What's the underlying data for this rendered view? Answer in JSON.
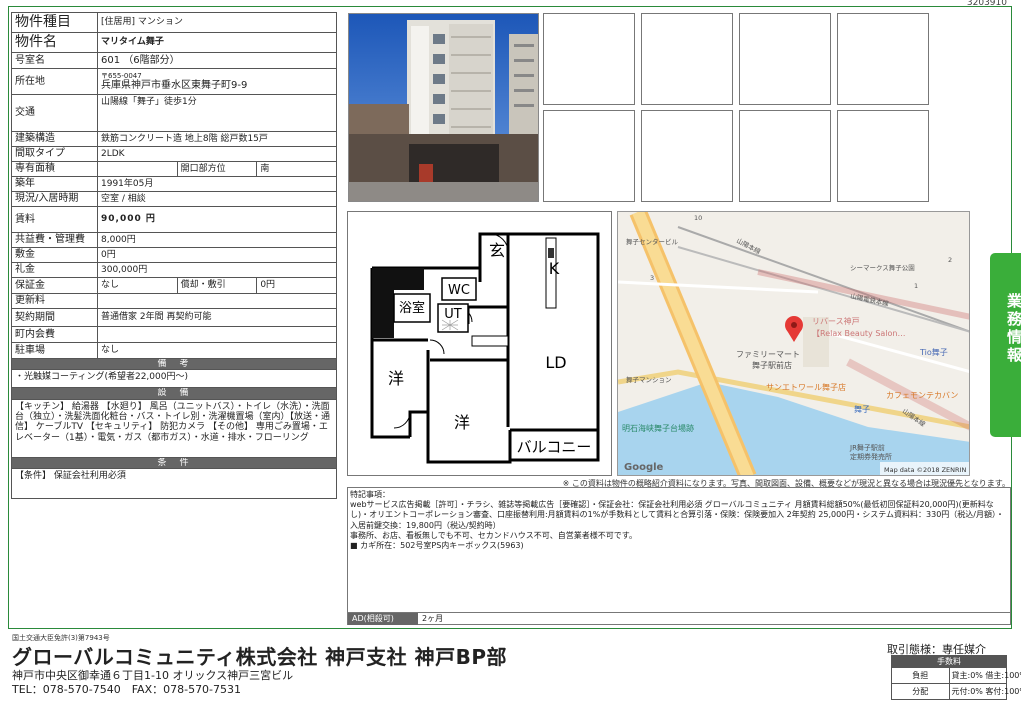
{
  "property_id": "3203910",
  "spec": {
    "type_label": "物件種目",
    "type_value": "[住居用] マンション",
    "name_label": "物件名",
    "name_value": "マリタイム舞子",
    "room_label": "号室名",
    "room_value": "601 （6階部分）",
    "address_label": "所在地",
    "postal": "〒655-0047",
    "address_value": "兵庫県神戸市垂水区東舞子町9-9",
    "access_label": "交通",
    "access_value": "山陽線「舞子」徒歩1分",
    "structure_label": "建築構造",
    "structure_value": "鉄筋コンクリート造 地上8階 総戸数15戸",
    "layout_label": "間取タイプ",
    "layout_value": "2LDK",
    "area_label": "専有面積",
    "area_value": "",
    "opening_label": "開口部方位",
    "opening_value": "南",
    "built_label": "築年",
    "built_value": "1991年05月",
    "status_label": "現況/入居時期",
    "status_value": "空室 / 相談",
    "rent_label": "賃料",
    "rent_value": "90,000 円",
    "fee_label": "共益費・管理費",
    "fee_value": "8,000円",
    "deposit_label": "敷金",
    "deposit_value": "0円",
    "keymoney_label": "礼金",
    "keymoney_value": "300,000円",
    "guarantee_label": "保証金",
    "guarantee_value": "なし",
    "amortize_label": "償却・敷引",
    "amortize_value": "0円",
    "renewal_label": "更新料",
    "renewal_value": "",
    "contract_label": "契約期間",
    "contract_value": "普通借家 2年間 再契約可能",
    "townfee_label": "町内会費",
    "townfee_value": "",
    "parking_label": "駐車場",
    "parking_value": "なし"
  },
  "sections": {
    "notes_title": "備　考",
    "notes_text": "・光触媒コーティング(希望者22,000円〜)",
    "equipment_title": "設　備",
    "equipment_text": "【キッチン】 給湯器 【水廻り】 風呂（ユニットバス）・トイレ（水洗）・洗面台（独立）・洗髪洗面化粧台・バス・トイレ別・洗濯機置場（室内）【放送・通信】 ケーブルTV 【セキュリティ】 防犯カメラ 【その他】 専用ごみ置場・エレベーター（1基）・電気・ガス（都市ガス）・水道・排水・フローリング",
    "conditions_title": "条　件",
    "conditions_text": "【条件】 保証会社利用必須"
  },
  "floorplan": {
    "entrance": "玄",
    "kitchen": "K",
    "wc": "WC",
    "bath": "浴室",
    "ut": "UT",
    "ld": "LD",
    "western1": "洋",
    "western2": "洋",
    "balcony": "バルコニー"
  },
  "map": {
    "labels": [
      "舞子センタービル",
      "山陽本線",
      "シーマークス舞子公園",
      "山陽電鉄本線",
      "リバース神戸",
      "【Relax Beauty Salon…",
      "Tio舞子",
      "ファミリーマート",
      "舞子駅前店",
      "舞子マンション",
      "サンエトワール舞子店",
      "カフェモンテカバン",
      "舞子",
      "山陽本線",
      "明石海峡舞子台場跡",
      "JR舞子駅前",
      "定期券発売所",
      "10",
      "1",
      "2",
      "3"
    ],
    "google": "Google",
    "copyright": "Map data ©2018 ZENRIN"
  },
  "disclaimer": "※ この資料は物件の概略紹介資料になります。写真、間取図面、設備、概要などが現況と異なる場合は現況優先となります。",
  "remarks": {
    "text": "特記事項：\nwebサービス広告掲載［許可］・チラシ、雑誌等掲載広告［要確認］・保証会社：保証会社利用必須 グローバルコミュニティ 月額賃料総額50%(最低初回保証料20,000円)(更新料なし)・オリエントコーポレーション審査、口座振替利用:月額賃料の1%が手数料として賃料と合算引落・保険：保険要加入 2年契約 25,000円・システム資料料：330円（税込/月額）・入居前鍵交換：19,800円（税込/契約時）\n事務所、お店、看板無しでも不可、セカンドハウス不可、自営業者様不可です。\n■ カギ所在：502号室PS内キーボックス(5963)",
    "ad_label": "AD(相殺可)",
    "ad_value": "2ヶ月"
  },
  "side_tab": "業務情報",
  "footer": {
    "license": "国土交通大臣免許(3)第7943号",
    "company": "グローバルコミュニティ株式会社 神戸支社 神戸BP部",
    "address": "神戸市中央区御幸通６丁目1-10 オリックス神戸三宮ビル",
    "tel": "TEL：078-570-7540　FAX：078-570-7531",
    "deal_title": "取引態様：専任媒介",
    "fee_header": "手数料",
    "burden_label": "負担",
    "burden_value": "貸主:0% 借主:100%",
    "split_label": "分配",
    "split_value": "元付:0% 客付:100%"
  },
  "colors": {
    "accent_green": "#3aae3a",
    "header_gray": "#666666"
  }
}
